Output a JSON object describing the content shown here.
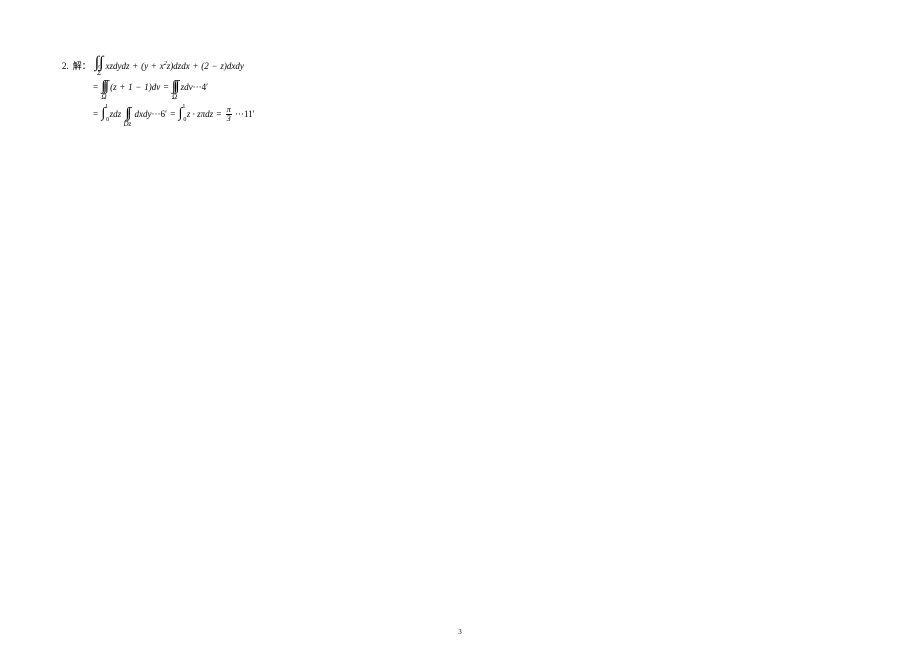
{
  "problem": {
    "number": "2.",
    "label": "解："
  },
  "line1": {
    "surface": "Σ",
    "expr": "xzdydz + (y + x²z)dzdx + (2 − z)dxdy"
  },
  "line2": {
    "region1": "Ω",
    "expr1": "(z + 1 − 1)dv",
    "region2": "Ω",
    "expr2": "zdv",
    "marker": "···4′"
  },
  "line3": {
    "int_lower": "0",
    "int_upper": "1",
    "expr1": "zdz",
    "region": "Dz",
    "expr2": "dxdy",
    "marker1": "···6′",
    "int2_lower": "0",
    "int2_upper": "1",
    "expr3": "z · zπdz",
    "frac_num": "π",
    "frac_den": "3",
    "marker2": "···11′"
  },
  "page": "3"
}
